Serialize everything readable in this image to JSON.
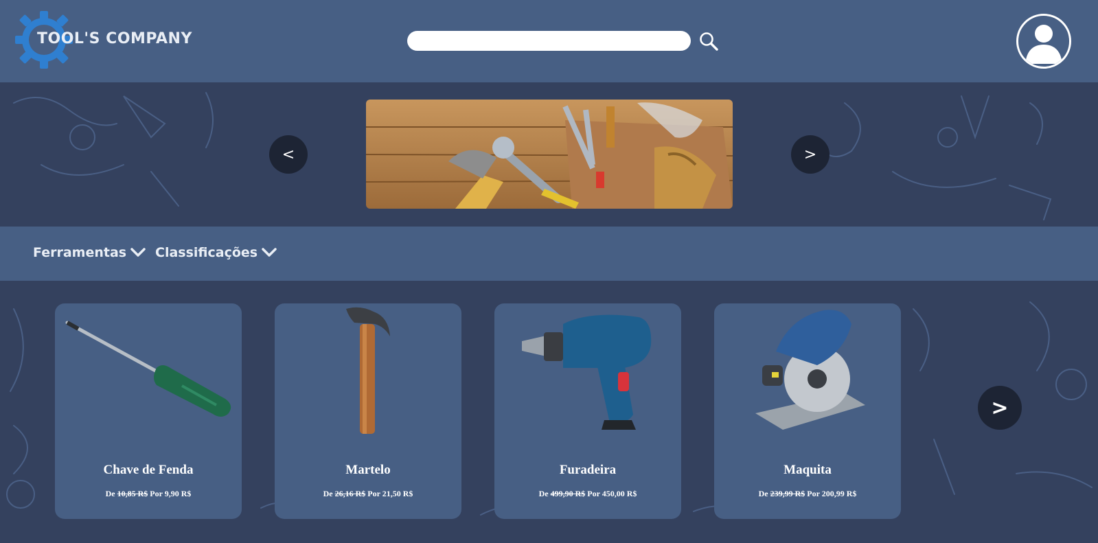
{
  "header": {
    "logo_text": "TOOL'S COMPANY",
    "search": {
      "value": "",
      "placeholder": ""
    }
  },
  "banner": {
    "prev_label": "<",
    "next_label": ">"
  },
  "categories": [
    {
      "label": "Ferramentas"
    },
    {
      "label": "Classificações"
    }
  ],
  "products": [
    {
      "name": "Chave de Fenda",
      "de_label": "De",
      "old_price": "10,85 R$",
      "por_label": "Por",
      "new_price": "9,90 R$"
    },
    {
      "name": "Martelo",
      "de_label": "De",
      "old_price": "26,16 R$",
      "por_label": "Por",
      "new_price": "21,50 R$"
    },
    {
      "name": "Furadeira",
      "de_label": "De",
      "old_price": "499,90 R$",
      "por_label": "Por",
      "new_price": "450,00 R$"
    },
    {
      "name": "Maquita",
      "de_label": "De",
      "old_price": "239,99 R$",
      "por_label": "Por",
      "new_price": "200,99 R$"
    }
  ],
  "products_next_label": ">",
  "colors": {
    "header_bg": "#475f84",
    "page_bg": "#34415e",
    "card_bg": "#475f84",
    "arrow_bg": "#1d2434",
    "logo_gear": "#2f7fd0"
  }
}
